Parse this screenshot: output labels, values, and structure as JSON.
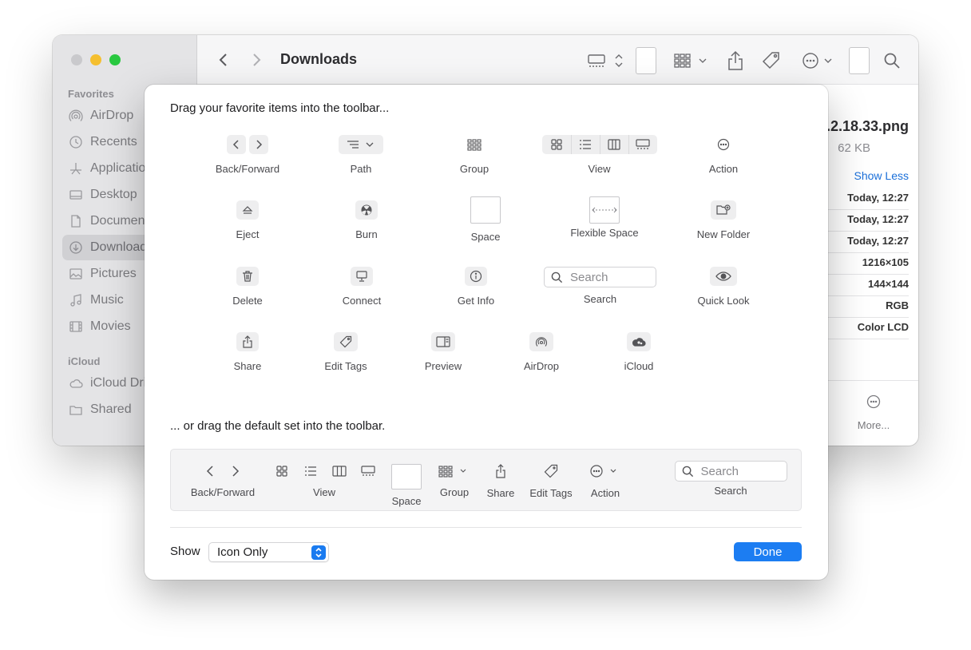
{
  "window": {
    "title": "Downloads",
    "sidebar": {
      "favorites_label": "Favorites",
      "icloud_label": "iCloud",
      "items": [
        {
          "label": "AirDrop"
        },
        {
          "label": "Recents"
        },
        {
          "label": "Applications"
        },
        {
          "label": "Desktop"
        },
        {
          "label": "Documents"
        },
        {
          "label": "Downloads"
        },
        {
          "label": "Pictures"
        },
        {
          "label": "Music"
        },
        {
          "label": "Movies"
        }
      ],
      "icloud_items": [
        {
          "label": "iCloud Drive"
        },
        {
          "label": "Shared"
        }
      ]
    },
    "info_pane": {
      "filename_fragment": ".2.18.33.png",
      "size_fragment": "62 KB",
      "show_less": "Show Less",
      "rows": [
        "Today, 12:27",
        "Today, 12:27",
        "Today, 12:27",
        "1216×105",
        "144×144",
        "RGB",
        "Color LCD"
      ],
      "more_label": "More..."
    }
  },
  "sheet": {
    "heading": "Drag your favorite items into the toolbar...",
    "items": {
      "back_forward": "Back/Forward",
      "path": "Path",
      "group": "Group",
      "view": "View",
      "action": "Action",
      "eject": "Eject",
      "burn": "Burn",
      "space": "Space",
      "flexible_space": "Flexible Space",
      "new_folder": "New Folder",
      "delete": "Delete",
      "connect": "Connect",
      "get_info": "Get Info",
      "search": "Search",
      "search_placeholder": "Search",
      "quick_look": "Quick Look",
      "share": "Share",
      "edit_tags": "Edit Tags",
      "preview": "Preview",
      "airdrop": "AirDrop",
      "icloud": "iCloud"
    },
    "default_set_heading": "... or drag the default set into the toolbar.",
    "default_set": {
      "back_forward": "Back/Forward",
      "view": "View",
      "space": "Space",
      "group": "Group",
      "share": "Share",
      "edit_tags": "Edit Tags",
      "action": "Action",
      "search": "Search",
      "search_placeholder": "Search"
    },
    "show_label": "Show",
    "show_value": "Icon Only",
    "done_label": "Done"
  },
  "colors": {
    "accent": "#1c7df2",
    "traffic_min": "#f5bf2f",
    "traffic_max": "#29c840"
  }
}
